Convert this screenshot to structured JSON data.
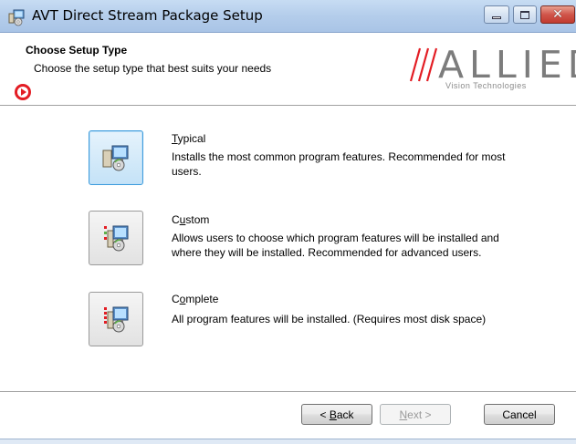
{
  "window": {
    "title": "AVT Direct Stream Package Setup",
    "icons": {
      "app": "setup-package-icon",
      "minimize": "minimize-icon",
      "maximize": "maximize-icon",
      "close": "close-icon"
    },
    "close_glyph": "✕"
  },
  "header": {
    "title": "Choose Setup Type",
    "subtitle": "Choose the setup type that best suits your needs",
    "badge_icon": "red-play-badge-icon",
    "logo": {
      "word": "ALLIED",
      "sub": "Vision Technologies",
      "color": "#7c7c7c"
    }
  },
  "options": [
    {
      "key": "typical",
      "title_mnemonic": "T",
      "title_rest": "ypical",
      "description": "Installs the most common program features. Recommended for most users.",
      "icon": "typical-install-icon",
      "selected": true
    },
    {
      "key": "custom",
      "title_prefix": "C",
      "title_mnemonic": "u",
      "title_rest": "stom",
      "description": "Allows users to choose which program features will be installed and where they will be installed. Recommended for advanced users.",
      "icon": "custom-install-icon",
      "selected": false
    },
    {
      "key": "complete",
      "title_prefix": "C",
      "title_mnemonic": "o",
      "title_rest": "mplete",
      "description": "All program features will be installed. (Requires most disk space)",
      "icon": "complete-install-icon",
      "selected": false
    }
  ],
  "buttons": {
    "back": {
      "prefix": "< ",
      "mnemonic": "B",
      "rest": "ack"
    },
    "next": {
      "mnemonic": "N",
      "rest": "ext >",
      "enabled": false
    },
    "cancel": {
      "label": "Cancel"
    }
  },
  "colors": {
    "accent": "#3c9bdc",
    "brand_red": "#e31d24",
    "titlebar": "#b4cdeb"
  }
}
